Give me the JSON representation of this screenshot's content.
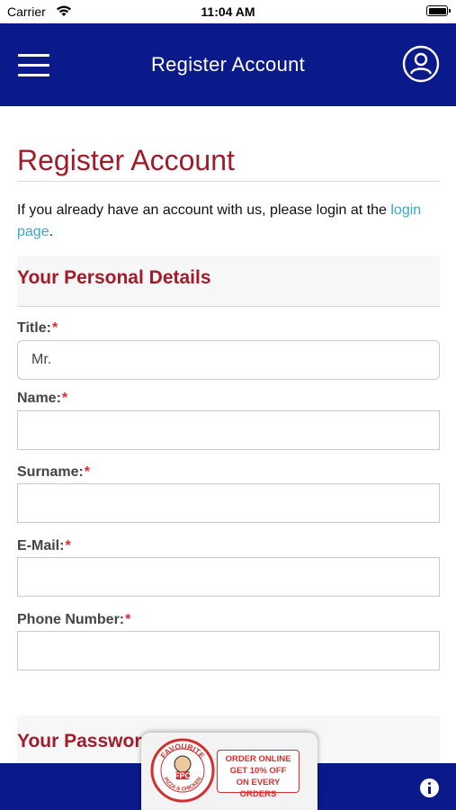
{
  "status_bar": {
    "carrier": "Carrier",
    "time": "11:04 AM"
  },
  "header": {
    "title": "Register Account",
    "menu_icon": "hamburger-icon",
    "profile_icon": "user-circle-icon"
  },
  "page": {
    "title": "Register Account",
    "intro_text": "If you already have an account with us, please login at the ",
    "login_link": "login page",
    "intro_end": "."
  },
  "personal_section": {
    "title": "Your Personal Details",
    "fields": {
      "title": {
        "label": "Title:",
        "value": "Mr."
      },
      "name": {
        "label": "Name:",
        "value": ""
      },
      "surname": {
        "label": "Surname:",
        "value": ""
      },
      "email": {
        "label": "E-Mail:",
        "value": ""
      },
      "phone": {
        "label": "Phone Number:",
        "value": ""
      }
    },
    "required_mark": "*"
  },
  "password_section": {
    "title": "Your Password"
  },
  "promo": {
    "logo_top": "FAVOURITE",
    "logo_mid": "FPC",
    "logo_bottom": "PIZZA & CHICKEN",
    "line1": "ORDER ONLINE",
    "line2": "GET 10% OFF",
    "line3": "ON EVERY ORDERS"
  },
  "colors": {
    "header_bg": "#0b1a8a",
    "accent_red": "#a01c2a",
    "link": "#3aa6c9"
  }
}
